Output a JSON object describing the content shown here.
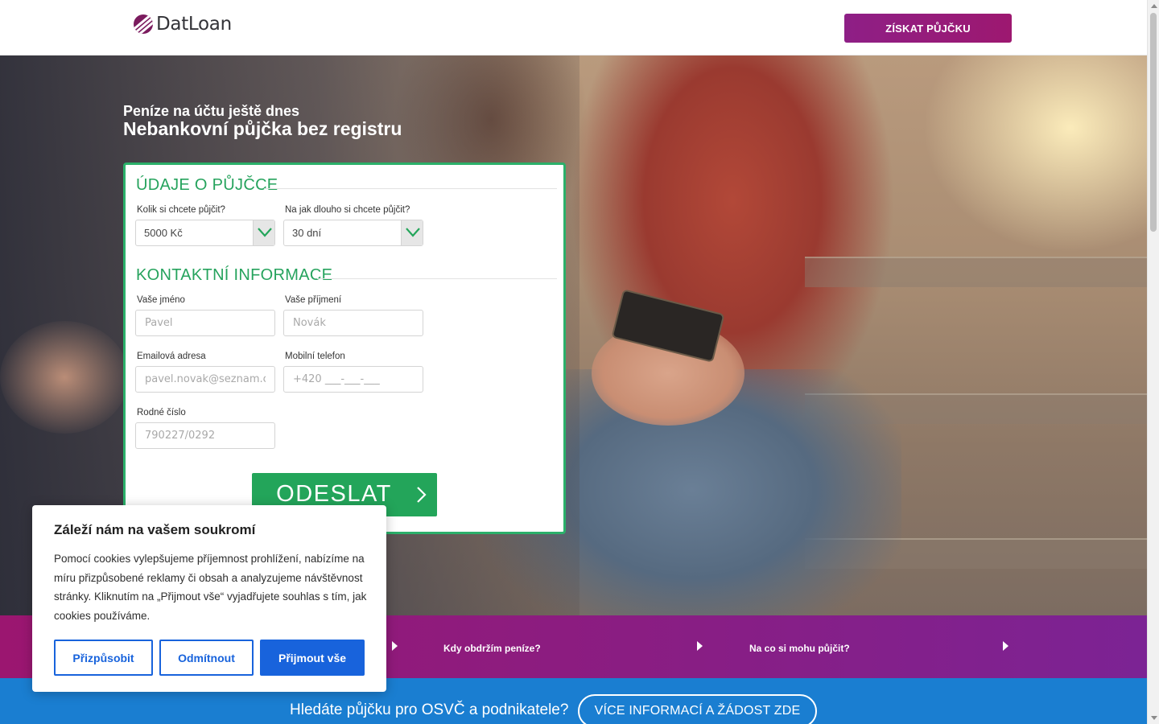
{
  "header": {
    "logo_text": "DatLoan",
    "cta_label": "ZÍSKAT PŮJČKU"
  },
  "hero": {
    "subtitle": "Peníze na účtu ještě dnes",
    "title": "Nebankovní půjčka bez registru"
  },
  "form": {
    "loan_section_title": "ÚDAJE O PŮJČCE",
    "amount_label": "Kolik si chcete půjčit?",
    "amount_value": "5000 Kč",
    "duration_label": "Na jak dlouho si chcete půjčit?",
    "duration_value": "30 dní",
    "contact_section_title": "KONTAKTNÍ INFORMACE",
    "first_name_label": "Vaše jméno",
    "first_name_placeholder": "Pavel",
    "last_name_label": "Vaše příjmení",
    "last_name_placeholder": "Novák",
    "email_label": "Emailová adresa",
    "email_placeholder": "pavel.novak@seznam.cz",
    "phone_label": "Mobilní telefon",
    "phone_placeholder": "+420 ___-___-___",
    "birth_number_label": "Rodné číslo",
    "birth_number_placeholder": "790227/0292",
    "submit_label": "ODESLAT"
  },
  "info_strip": {
    "items": [
      {
        "label": "Kdy obdržím peníze?"
      },
      {
        "label": "Na co si mohu půjčit?"
      }
    ]
  },
  "business": {
    "text": "Hledáte půjčku pro OSVČ a podnikatele?",
    "button_label": "VÍCE INFORMACÍ A ŽÁDOST ZDE"
  },
  "cookie": {
    "title": "Záleží nám na vašem soukromí",
    "body": "Pomocí cookies vylepšujeme příjemnost prohlížení, nabízíme na míru přizpůsobené reklamy či obsah a analyzujeme návštěvnost stránky. Kliknutím na „Přijmout vše“ vyjadřujete souhlas s tím, jak cookies používáme.",
    "customize_label": "Přizpůsobit",
    "reject_label": "Odmítnout",
    "accept_label": "Přijmout vše"
  },
  "colors": {
    "brand_purple": "#8e1f86",
    "form_green": "#23a55a",
    "business_blue": "#1a7ed1",
    "cookie_blue": "#1863dc"
  }
}
